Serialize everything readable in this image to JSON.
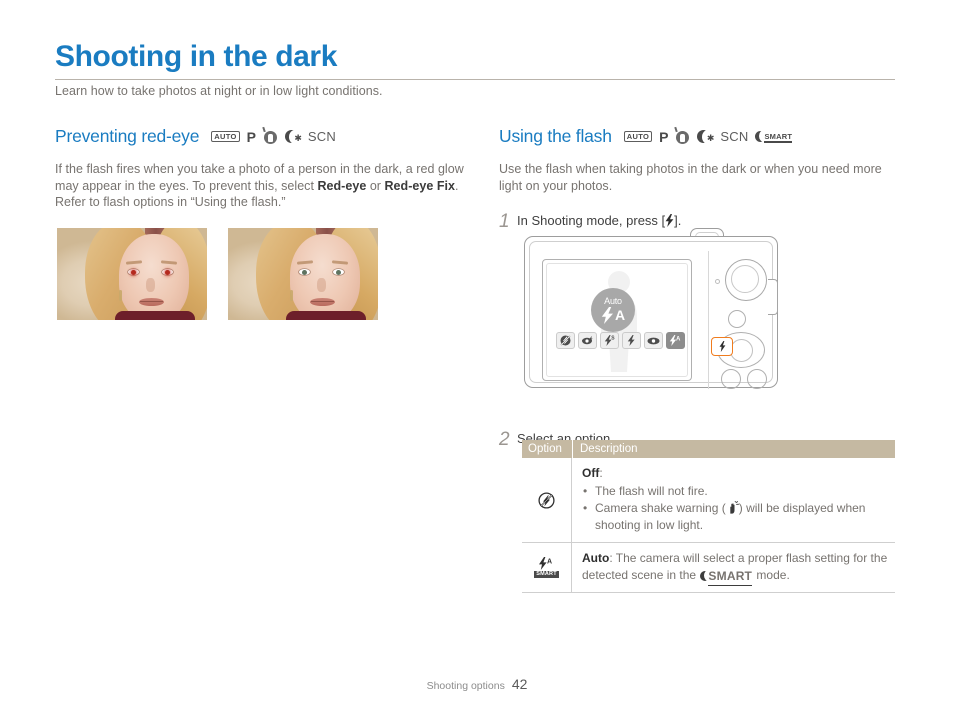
{
  "document": {
    "title": "Shooting in the dark",
    "subtitle": "Learn how to take photos at night or in low light conditions.",
    "footer_label": "Shooting options",
    "page_number": "42",
    "accent_color": "#1a7cc1",
    "table_header_color": "#c5b9a2",
    "highlight_color": "#f07c1e"
  },
  "left_section": {
    "heading": "Preventing red-eye",
    "modes": [
      {
        "name": "mode-auto",
        "label": "AUTO"
      },
      {
        "name": "mode-program",
        "label": "P"
      },
      {
        "name": "mode-dual-is",
        "label": ""
      },
      {
        "name": "mode-night",
        "label": ""
      },
      {
        "name": "mode-scene",
        "label": "SCN"
      }
    ],
    "paragraph_parts": [
      {
        "text": "If the flash fires when you take a photo of a person in the dark, a red glow may appear in the eyes. To prevent this, select ",
        "bold": false
      },
      {
        "text": "Red-eye",
        "bold": true
      },
      {
        "text": " or ",
        "bold": false
      },
      {
        "text": "Red-eye Fix",
        "bold": true
      },
      {
        "text": ". Refer to flash options in “Using the flash.”",
        "bold": false
      }
    ],
    "photos": [
      {
        "name": "photo-with-red-eye",
        "caption": ""
      },
      {
        "name": "photo-red-eye-corrected",
        "caption": ""
      }
    ]
  },
  "right_section": {
    "heading": "Using the flash",
    "modes": [
      {
        "name": "mode-auto",
        "label": "AUTO"
      },
      {
        "name": "mode-program",
        "label": "P"
      },
      {
        "name": "mode-dual-is",
        "label": ""
      },
      {
        "name": "mode-night",
        "label": ""
      },
      {
        "name": "mode-scene",
        "label": "SCN"
      },
      {
        "name": "mode-smart-auto",
        "label": "SMART"
      }
    ],
    "paragraph": "Use the flash when taking photos in the dark or when you need more light on your photos.",
    "steps": [
      {
        "number": "1",
        "text_before": "In Shooting mode, press [",
        "text_after": "].",
        "icon": "flash-icon"
      },
      {
        "number": "2",
        "text_before": "Select an option.",
        "text_after": "",
        "icon": ""
      }
    ],
    "camera": {
      "screen": {
        "badge_label": "Auto",
        "badge_symbol": "A",
        "options": [
          {
            "name": "flash-off-option",
            "selected": false
          },
          {
            "name": "red-eye-option",
            "selected": false
          },
          {
            "name": "slow-sync-option",
            "selected": false
          },
          {
            "name": "fill-in-option",
            "selected": false
          },
          {
            "name": "red-eye-fix-option",
            "selected": false
          },
          {
            "name": "auto-flash-option",
            "selected": true
          }
        ]
      },
      "flash_button_highlighted": true
    }
  },
  "table": {
    "headers": [
      "Option",
      "Description"
    ],
    "rows": [
      {
        "icon": "flash-off-icon",
        "title": "Off",
        "title_suffix": ":",
        "bullets": [
          {
            "before": "The flash will not fire.",
            "icon": "",
            "after": ""
          },
          {
            "before": "Camera shake warning (",
            "icon": "shake-icon",
            "after": ") will be displayed when shooting in low light."
          }
        ],
        "body": ""
      },
      {
        "icon": "smart-auto-flash-icon",
        "title": "Auto",
        "title_suffix": ": ",
        "bullets": [],
        "body_before": "The camera will select a proper flash setting for the detected scene in the ",
        "body_icon": "smart-icon",
        "body_after": " mode."
      }
    ]
  }
}
